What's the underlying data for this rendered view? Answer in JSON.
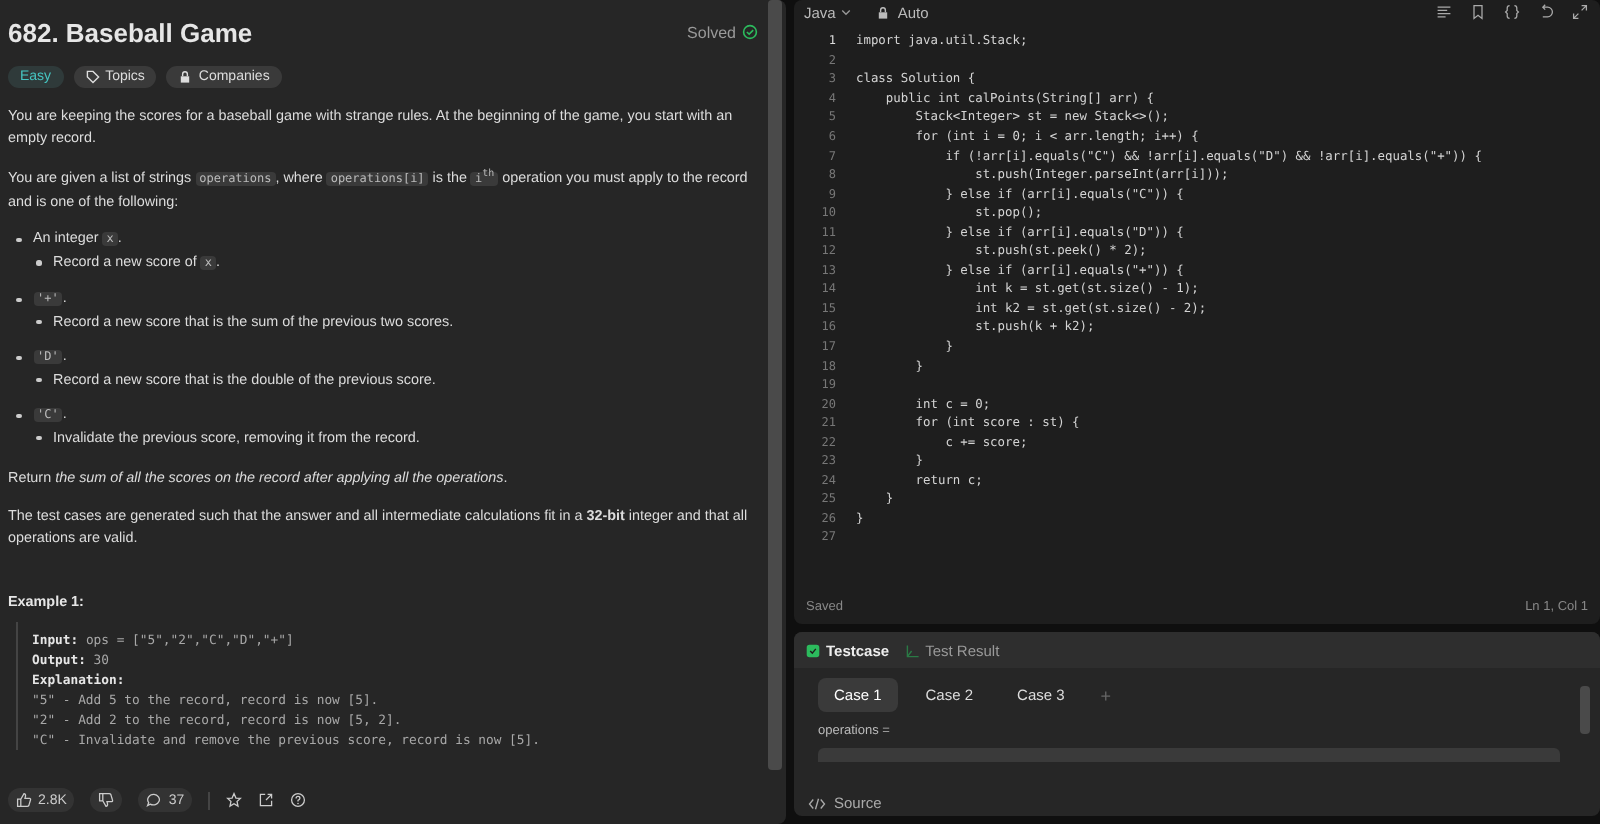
{
  "problem": {
    "title": "682. Baseball Game",
    "status": "Solved",
    "tags": [
      {
        "kind": "difficulty",
        "label": "Easy"
      },
      {
        "kind": "topics",
        "label": "Topics"
      },
      {
        "kind": "companies",
        "label": "Companies"
      }
    ],
    "paragraphs": [
      [
        {
          "kind": "text",
          "text": "You are keeping the scores for a baseball game with strange rules. At the beginning of the game, you start with an empty record."
        }
      ],
      [
        {
          "kind": "text",
          "text": "You are given a list of strings "
        },
        {
          "kind": "code",
          "text": "operations"
        },
        {
          "kind": "text",
          "text": ", where "
        },
        {
          "kind": "code",
          "text": "operations[i]"
        },
        {
          "kind": "text",
          "text": " is the "
        },
        {
          "kind": "code",
          "text": "i$^{th}$"
        },
        {
          "kind": "text",
          "text": " operation you must apply to the record and is one of the following:"
        }
      ]
    ],
    "rules": [
      {
        "head": [
          {
            "kind": "text",
            "text": "An integer "
          },
          {
            "kind": "code",
            "text": "x"
          },
          {
            "kind": "text",
            "text": "."
          }
        ],
        "detail": [
          {
            "kind": "text",
            "text": "Record a new score of "
          },
          {
            "kind": "code",
            "text": "x"
          },
          {
            "kind": "text",
            "text": "."
          }
        ]
      },
      {
        "head": [
          {
            "kind": "code",
            "text": "'+'"
          },
          {
            "kind": "text",
            "text": "."
          }
        ],
        "detail": [
          {
            "kind": "text",
            "text": "Record a new score that is the sum of the previous two scores."
          }
        ]
      },
      {
        "head": [
          {
            "kind": "code",
            "text": "'D'"
          },
          {
            "kind": "text",
            "text": "."
          }
        ],
        "detail": [
          {
            "kind": "text",
            "text": "Record a new score that is the double of the previous score."
          }
        ]
      },
      {
        "head": [
          {
            "kind": "code",
            "text": "'C'"
          },
          {
            "kind": "text",
            "text": "."
          }
        ],
        "detail": [
          {
            "kind": "text",
            "text": "Invalidate the previous score, removing it from the record."
          }
        ]
      }
    ],
    "closing": [
      "Return *the sum of all the scores on the record after applying all the operations*.",
      "The test cases are generated such that the answer and all intermediate calculations fit in a **32-bit** integer and that all operations are valid."
    ],
    "example_title": "Example 1:",
    "example_lines": [
      "**Input:** ops = [\"5\",\"2\",\"C\",\"D\",\"+\"]",
      "**Output:** 30",
      "**Explanation:**",
      "\"5\" - Add 5 to the record, record is now [5].",
      "\"2\" - Add 2 to the record, record is now [5, 2].",
      "\"C\" - Invalidate and remove the previous score, record is now [5]."
    ]
  },
  "actions": {
    "likes": "2.8K",
    "comments": "37"
  },
  "editor": {
    "language": "Java",
    "mode": "Auto",
    "lines": [
      {
        "number": "1",
        "text": "import java.util.Stack;"
      },
      {
        "number": "2"
      },
      {
        "number": "3",
        "text": "class Solution {"
      },
      {
        "number": "4",
        "text": "    public int calPoints(String[] arr) {"
      },
      {
        "number": "5",
        "text": "        Stack<Integer> st = new Stack<>();"
      },
      {
        "number": "6",
        "text": "        for (int i = 0; i < arr.length; i++) {"
      },
      {
        "number": "7",
        "text": "            if (!arr[i].equals(\"C\") && !arr[i].equals(\"D\") && !arr[i].equals(\"+\")) {"
      },
      {
        "number": "8",
        "text": "                st.push(Integer.parseInt(arr[i]));"
      },
      {
        "number": "9",
        "text": "            } else if (arr[i].equals(\"C\")) {"
      },
      {
        "number": "10",
        "text": "                st.pop();"
      },
      {
        "number": "11",
        "text": "            } else if (arr[i].equals(\"D\")) {"
      },
      {
        "number": "12",
        "text": "                st.push(st.peek() * 2);"
      },
      {
        "number": "13",
        "text": "            } else if (arr[i].equals(\"+\")) {"
      },
      {
        "number": "14",
        "text": "                int k = st.get(st.size() - 1);"
      },
      {
        "number": "15",
        "text": "                int k2 = st.get(st.size() - 2);"
      },
      {
        "number": "16",
        "text": "                st.push(k + k2);"
      },
      {
        "number": "17",
        "text": "            }"
      },
      {
        "number": "18",
        "text": "        }"
      },
      {
        "number": "19"
      },
      {
        "number": "20",
        "text": "        int c = 0;"
      },
      {
        "number": "21",
        "text": "        for (int score : st) {"
      },
      {
        "number": "22",
        "text": "            c += score;"
      },
      {
        "number": "23",
        "text": "        }"
      },
      {
        "number": "24",
        "text": "        return c;"
      },
      {
        "number": "25",
        "text": "    }"
      },
      {
        "number": "26",
        "text": "}"
      },
      {
        "number": "27"
      }
    ],
    "status": "Saved",
    "cursor": "Ln 1, Col 1"
  },
  "testpanel": {
    "tabs": [
      {
        "label": "Testcase",
        "selected": true
      },
      {
        "label": "Test Result",
        "selected": false
      }
    ],
    "cases": [
      {
        "label": "Case 1",
        "selected": true
      },
      {
        "label": "Case 2",
        "selected": false
      },
      {
        "label": "Case 3",
        "selected": false
      }
    ],
    "add": "+",
    "field_label": "operations =",
    "source": "Source"
  }
}
